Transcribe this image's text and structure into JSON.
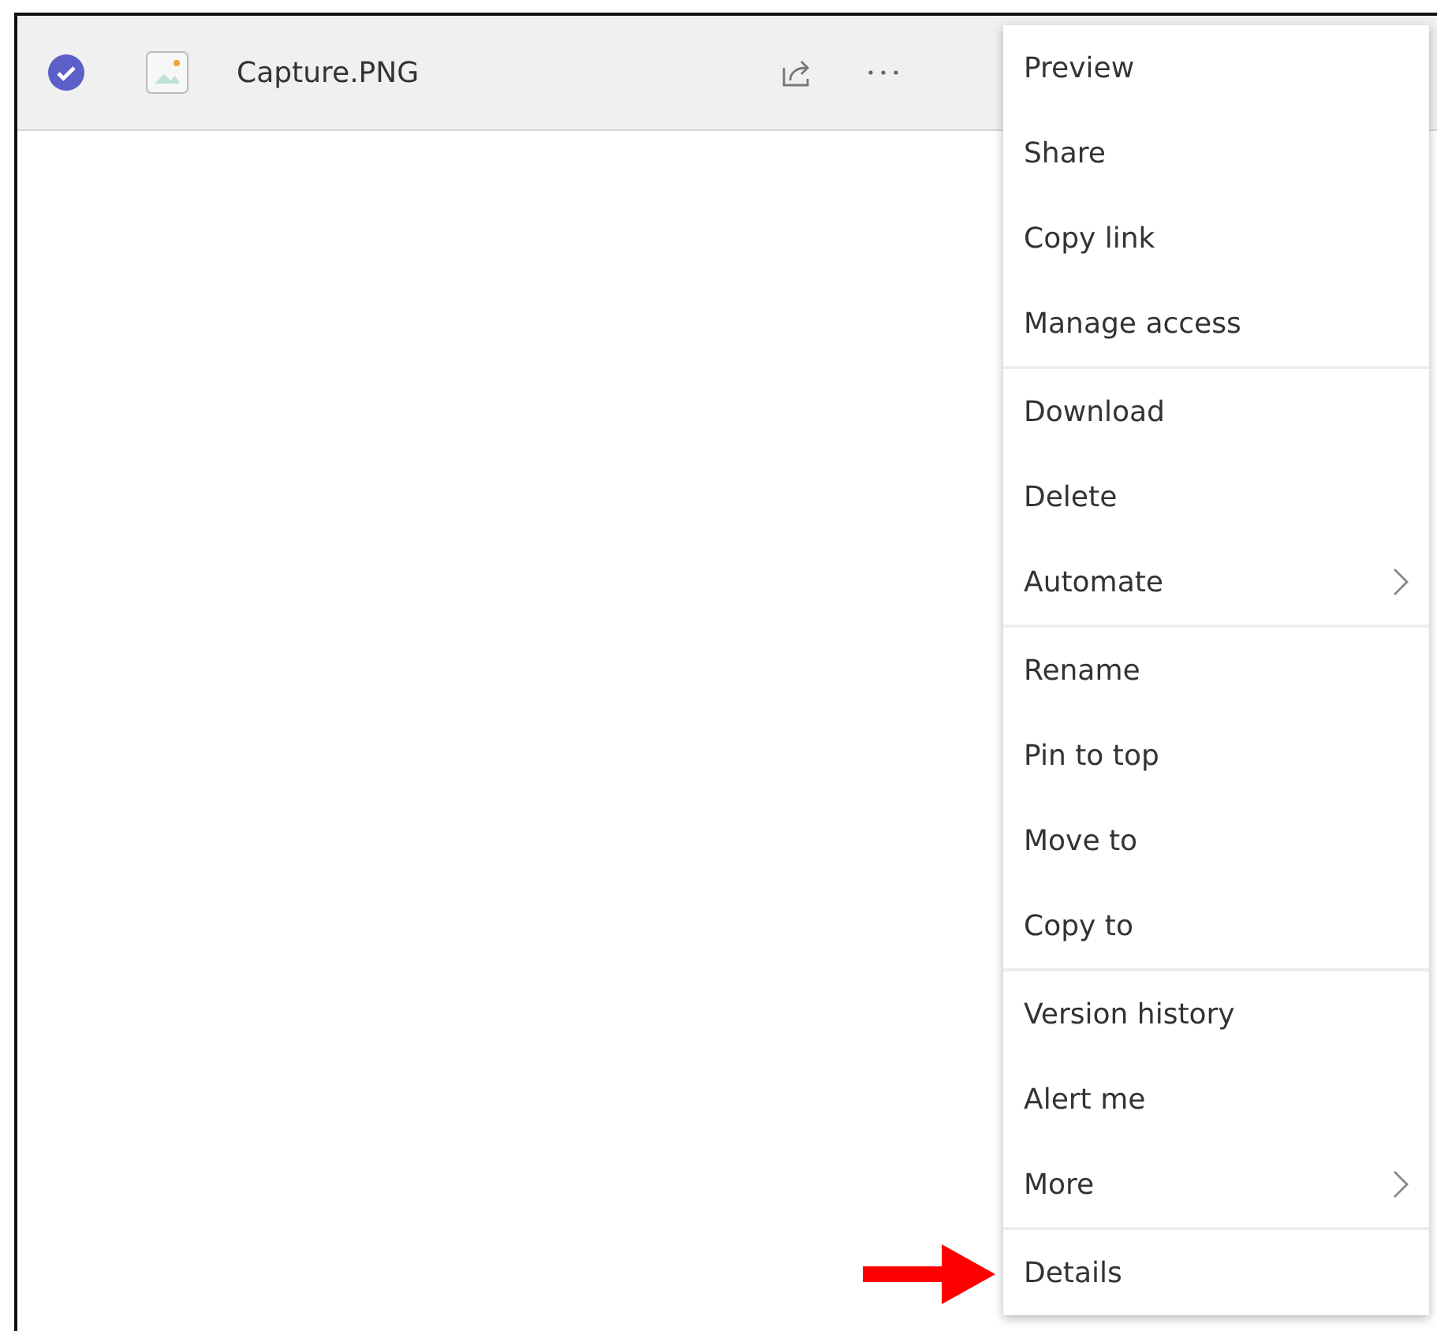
{
  "file_row": {
    "selected": true,
    "name": "Capture.PNG"
  },
  "context_menu": {
    "groups": [
      [
        {
          "label": "Preview",
          "submenu": false
        },
        {
          "label": "Share",
          "submenu": false
        },
        {
          "label": "Copy link",
          "submenu": false
        },
        {
          "label": "Manage access",
          "submenu": false
        }
      ],
      [
        {
          "label": "Download",
          "submenu": false
        },
        {
          "label": "Delete",
          "submenu": false
        },
        {
          "label": "Automate",
          "submenu": true
        }
      ],
      [
        {
          "label": "Rename",
          "submenu": false
        },
        {
          "label": "Pin to top",
          "submenu": false
        },
        {
          "label": "Move to",
          "submenu": false
        },
        {
          "label": "Copy to",
          "submenu": false
        }
      ],
      [
        {
          "label": "Version history",
          "submenu": false
        },
        {
          "label": "Alert me",
          "submenu": false
        },
        {
          "label": "More",
          "submenu": true
        }
      ],
      [
        {
          "label": "Details",
          "submenu": false
        }
      ]
    ]
  }
}
